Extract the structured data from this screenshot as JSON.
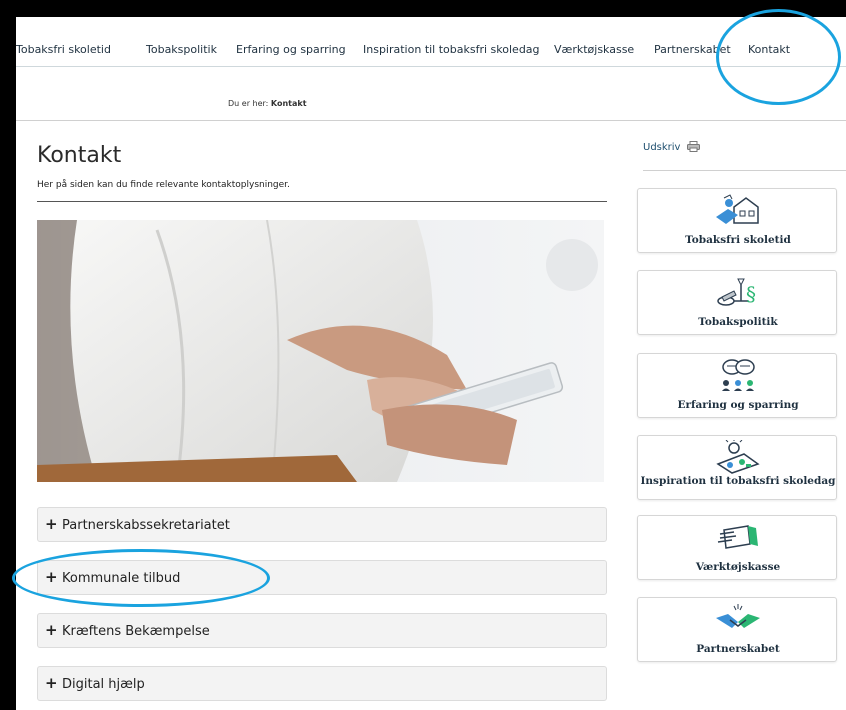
{
  "nav": {
    "items": [
      "Tobaksfri skoletid",
      "Tobakspolitik",
      "Erfaring og sparring",
      "Inspiration til tobaksfri skoledag",
      "Værktøjskasse",
      "Partnerskabet",
      "Kontakt"
    ]
  },
  "breadcrumb": {
    "prefix": "Du er her:",
    "current": "Kontakt"
  },
  "main": {
    "title": "Kontakt",
    "lead": "Her på siden kan du finde relevante kontaktoplysninger.",
    "accordion": [
      "Partnerskabssekretariatet",
      "Kommunale tilbud",
      "Kræftens Bekæmpelse",
      "Digital hjælp"
    ]
  },
  "sidebar": {
    "print_label": "Udskriv",
    "cards": [
      "Tobaksfri skoletid",
      "Tobakspolitik",
      "Erfaring og sparring",
      "Inspiration til tobaksfri skoledag",
      "Værktøjskasse",
      "Partnerskabet"
    ]
  },
  "colors": {
    "highlight_ring": "#1aa3df",
    "nav_text": "#1f3140",
    "accordion_bg": "#f3f3f3"
  }
}
